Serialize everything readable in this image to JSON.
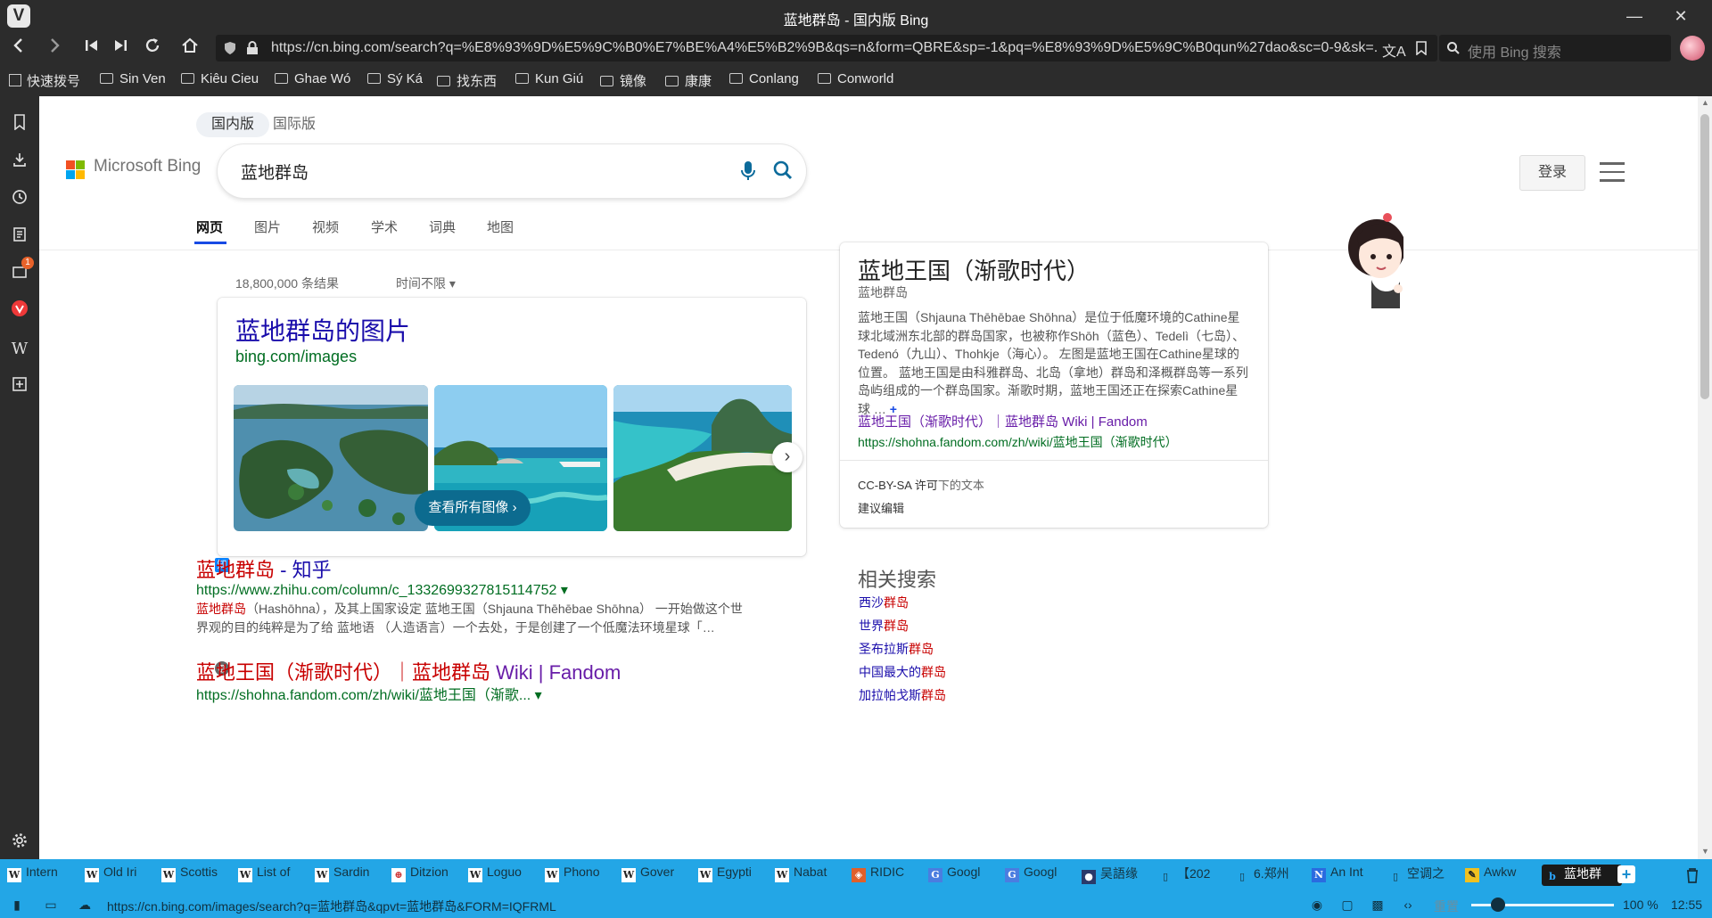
{
  "window": {
    "title": "蓝地群岛 - 国内版 Bing",
    "minimize_glyph": "—",
    "restore_glyph": "❐",
    "close_glyph": "✕"
  },
  "navbar": {
    "url": "https://cn.bing.com/search?q=%E8%93%9D%E5%9C%B0%E7%BE%A4%E5%B2%9B&qs=n&form=QBRE&sp=-1&pq=%E8%93%9D%E5%9C%B0qun%27dao&sc=0-9&sk=...",
    "search_placeholder": "使用 Bing 搜索"
  },
  "bookmarks": [
    {
      "label": "快速拨号"
    },
    {
      "label": "Sin Ven"
    },
    {
      "label": "Kiêu Cieu"
    },
    {
      "label": "Ghae Wó"
    },
    {
      "label": "Sý Ká"
    },
    {
      "label": "找东西"
    },
    {
      "label": "Kun Giú"
    },
    {
      "label": "镜像"
    },
    {
      "label": "康康"
    },
    {
      "label": "Conlang"
    },
    {
      "label": "Conworld"
    }
  ],
  "sidepanel": {
    "badge": "1"
  },
  "bing": {
    "logo_text": "Microsoft Bing",
    "scope_tabs": [
      "国内版",
      "国际版"
    ],
    "query": "蓝地群岛",
    "login": "登录",
    "vertical_tabs": [
      "网页",
      "图片",
      "视频",
      "学术",
      "词典",
      "地图"
    ],
    "result_count": "18,800,000 条结果",
    "time_filter": "时间不限 ▾",
    "images_card": {
      "title": "蓝地群岛的图片",
      "subtitle": "bing.com/images",
      "see_all": "查看所有图像 ›"
    },
    "results": [
      {
        "title_hl": "蓝地群岛",
        "title_rest": " - 知乎",
        "url": "https://www.zhihu.com/column/c_1332699327815114752 ▾",
        "snippet_hl": "蓝地群岛",
        "snippet": "（Hashōhna），及其上国家设定 蓝地王国（Shjauna Thēhēbae Shōhna） 一开始做这个世界观的目的纯粹是为了给 蓝地语 （人造语言）一个去处，于是创建了一个低魔法环境星球「…"
      },
      {
        "title_a": "蓝地王国（渐歌时代）｜",
        "title_hl": "蓝地群岛",
        "title_b": " Wiki | Fandom",
        "url": "https://shohna.fandom.com/zh/wiki/蓝地王国（渐歌... ▾"
      }
    ],
    "knowledge_panel": {
      "title": "蓝地王国（渐歌时代）",
      "subtitle": "蓝地群岛",
      "body": "蓝地王国（Shjauna Thēhēbae Shōhna）是位于低魔环境的Cathine星球北域洲东北部的群岛国家，也被称作Shōh（蓝色）、Tedelì（七岛）、Tedenó（九山）、Thohkje（海心）。 左图是蓝地王国在Cathine星球的位置。 蓝地王国是由科雅群岛、北岛（拿地）群岛和泽概群岛等一系列岛屿组成的一个群岛国家。渐歌时期，蓝地王国还正在探索Cathine星球 …",
      "more": "+",
      "link": "蓝地王国（渐歌时代）｜蓝地群岛 Wiki | Fandom",
      "link_url": "https://shohna.fandom.com/zh/wiki/蓝地王国（渐歌时代）",
      "license_a": "CC-BY-SA 许可",
      "license_b": "下的文本",
      "suggest_edit": "建议编辑"
    },
    "related": {
      "title": "相关搜索",
      "items": [
        {
          "pre": "西沙",
          "hl": "群岛"
        },
        {
          "pre": "世界",
          "hl": "群岛"
        },
        {
          "pre": "圣布拉斯",
          "hl": "群岛"
        },
        {
          "pre": "中国最大的",
          "hl": "群岛"
        },
        {
          "pre": "加拉帕戈斯",
          "hl": "群岛"
        }
      ]
    }
  },
  "tabs": [
    {
      "icon": "W",
      "label": "Intern"
    },
    {
      "icon": "W",
      "label": "Old Iri"
    },
    {
      "icon": "W",
      "label": "Scottis"
    },
    {
      "icon": "W",
      "label": "List of"
    },
    {
      "icon": "W",
      "label": "Sardin"
    },
    {
      "icon": "⊕",
      "label": "Ditzion"
    },
    {
      "icon": "W",
      "label": "Loguo"
    },
    {
      "icon": "W",
      "label": "Phono"
    },
    {
      "icon": "W",
      "label": "Gover"
    },
    {
      "icon": "W",
      "label": "Egypti"
    },
    {
      "icon": "W",
      "label": "Nabat"
    },
    {
      "icon": "◈",
      "label": "RIDIC"
    },
    {
      "icon": "G",
      "label": "Googl"
    },
    {
      "icon": "G",
      "label": "Googl"
    },
    {
      "icon": "●",
      "label": "吴語缘"
    },
    {
      "icon": "▯",
      "label": "【202"
    },
    {
      "icon": "▯",
      "label": "6.郑州"
    },
    {
      "icon": "N",
      "label": "An Int"
    },
    {
      "icon": "▯",
      "label": "空调之"
    },
    {
      "icon": "✎",
      "label": "Awkw"
    },
    {
      "icon": "b",
      "label": "蓝地群"
    }
  ],
  "statusbar": {
    "url": "https://cn.bing.com/images/search?q=蓝地群岛&qpvt=蓝地群岛&FORM=IQFRML",
    "reset": "重置",
    "zoom": "100 %",
    "time": "12:55"
  }
}
